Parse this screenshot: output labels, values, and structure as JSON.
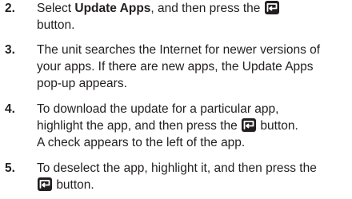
{
  "steps": [
    {
      "number": "2.",
      "l1_a": "Select ",
      "l1_bold": "Update Apps",
      "l1_b": ", and then press the",
      "l2_a": "button."
    },
    {
      "number": "3.",
      "l1": "The unit searches the Internet for newer versions of",
      "l2": "your apps. If there are new apps, the Update Apps",
      "l3": "pop-up appears."
    },
    {
      "number": "4.",
      "l1": "To download the update for a particular app,",
      "l2_a": "highlight the app, and then press the",
      "l2_b": "button.",
      "l3": "A check appears to the left of the app."
    },
    {
      "number": "5.",
      "l1": "To deselect the app, highlight it, and then press the",
      "l2_b": "button."
    }
  ],
  "icons": {
    "enter_button": "enter-button-icon",
    "icon_color": "#231f20"
  }
}
